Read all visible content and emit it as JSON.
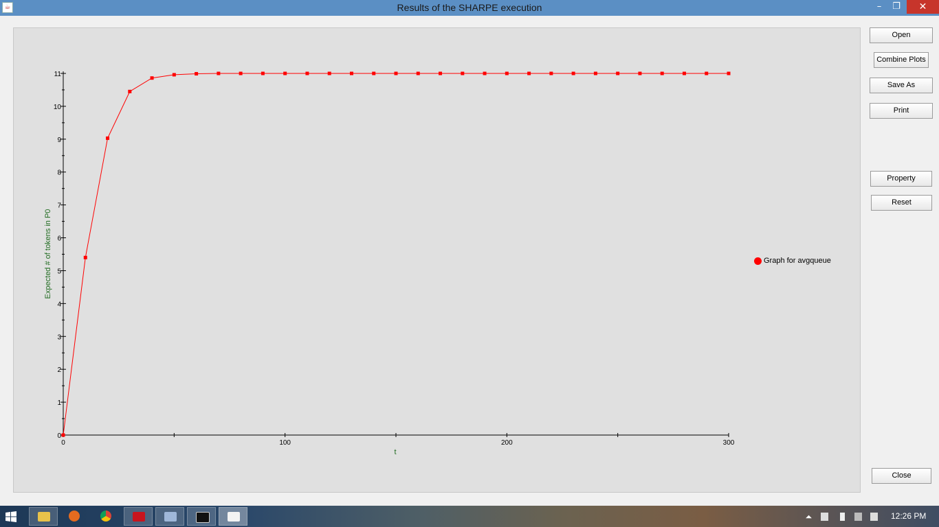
{
  "window": {
    "title": "Results of the SHARPE execution",
    "minimize_glyph": "–",
    "maximize_glyph": "❐",
    "close_glyph": "✕"
  },
  "buttons": {
    "open": "Open",
    "combine_plots": "Combine Plots",
    "save_as": "Save As",
    "print": "Print",
    "property": "Property",
    "reset": "Reset",
    "close": "Close"
  },
  "legend": {
    "label": "Graph for avgqueue",
    "color": "#ff0000"
  },
  "chart_data": {
    "type": "line",
    "xlabel": "t",
    "ylabel": "Expected # of tokens in P0",
    "xlim": [
      0,
      300
    ],
    "ylim": [
      0,
      11
    ],
    "x_ticks": [
      0,
      100,
      200,
      300
    ],
    "y_ticks": [
      0,
      1,
      2,
      3,
      4,
      5,
      6,
      7,
      8,
      9,
      10,
      11
    ],
    "grid": false,
    "legend_position": "right",
    "series": [
      {
        "name": "Graph for avgqueue",
        "color": "#ff0000",
        "x": [
          0,
          10,
          20,
          30,
          40,
          50,
          60,
          70,
          80,
          90,
          100,
          110,
          120,
          130,
          140,
          150,
          160,
          170,
          180,
          190,
          200,
          210,
          220,
          230,
          240,
          250,
          260,
          270,
          280,
          290,
          300
        ],
        "y": [
          0,
          5.4,
          9.03,
          10.45,
          10.86,
          10.96,
          10.99,
          11,
          11,
          11,
          11,
          11,
          11,
          11,
          11,
          11,
          11,
          11,
          11,
          11,
          11,
          11,
          11,
          11,
          11,
          11,
          11,
          11,
          11,
          11,
          11
        ]
      }
    ]
  },
  "taskbar": {
    "time": "12:26 PM",
    "items": [
      "file-explorer-icon",
      "firefox-icon",
      "chrome-icon",
      "acrobat-icon",
      "paint-icon",
      "cmd-icon",
      "java-icon"
    ]
  }
}
